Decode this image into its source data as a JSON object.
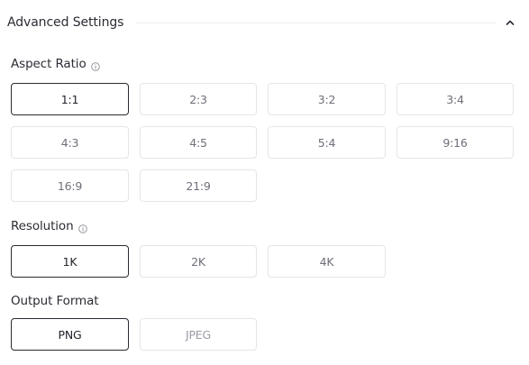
{
  "header": {
    "title": "Advanced Settings",
    "toggle_icon": "chevron-up-icon"
  },
  "aspect_ratio": {
    "label": "Aspect Ratio",
    "info_icon": "info-icon",
    "selected": "1:1",
    "options": [
      "1:1",
      "2:3",
      "3:2",
      "3:4",
      "4:3",
      "4:5",
      "5:4",
      "9:16",
      "16:9",
      "21:9"
    ]
  },
  "resolution": {
    "label": "Resolution",
    "info_icon": "info-icon",
    "selected": "1K",
    "options": [
      "1K",
      "2K",
      "4K"
    ]
  },
  "output_format": {
    "label": "Output Format",
    "selected": "PNG",
    "options": [
      "PNG",
      "JPEG"
    ]
  },
  "colors": {
    "selected_border": "#2a2b33",
    "option_border": "#e5e5ea",
    "option_text": "#6e6f7a"
  }
}
